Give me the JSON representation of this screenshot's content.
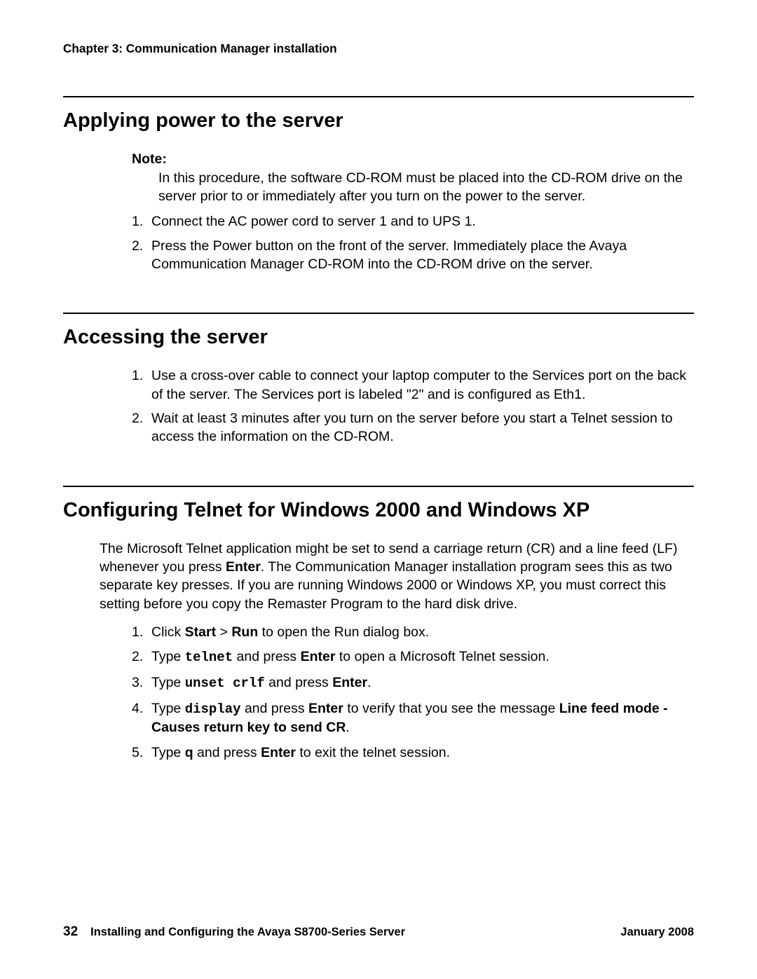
{
  "chapterHeader": "Chapter 3: Communication Manager installation",
  "section1": {
    "title": "Applying power to the server",
    "noteLabel": "Note:",
    "noteText": "In this procedure, the software CD-ROM must be placed into the CD-ROM drive on the server prior to or immediately after you turn on the power to the server.",
    "steps": [
      "Connect the AC power cord to server 1 and to UPS 1.",
      "Press the Power button on the front of the server. Immediately place the Avaya Communication Manager CD-ROM into the CD-ROM drive on the server."
    ]
  },
  "section2": {
    "title": "Accessing the server",
    "steps": [
      "Use a cross-over cable to connect your laptop computer to the Services port on the back of the server. The Services port is labeled \"2\" and is configured as Eth1.",
      "Wait at least 3 minutes after you turn on the server before you start a Telnet session to access the information on the CD-ROM."
    ]
  },
  "section3": {
    "title": "Configuring Telnet for Windows 2000 and Windows XP",
    "intro": {
      "p1a": "The Microsoft Telnet application might be set to send a carriage return (CR) and a line feed (LF) whenever you press ",
      "p1b": "Enter",
      "p1c": ". The Communication Manager installation program sees this as two separate key presses. If you are running Windows 2000 or Windows XP, you must correct this setting before you copy the Remaster Program to the hard disk drive."
    },
    "steps": {
      "s1a": "Click ",
      "s1b": "Start",
      "s1c": " > ",
      "s1d": "Run",
      "s1e": " to open the Run dialog box.",
      "s2a": "Type ",
      "s2b": "telnet",
      "s2c": " and press ",
      "s2d": "Enter",
      "s2e": " to open a Microsoft Telnet session.",
      "s3a": "Type ",
      "s3b": "unset crlf",
      "s3c": " and press ",
      "s3d": "Enter",
      "s3e": ".",
      "s4a": "Type ",
      "s4b": "display",
      "s4c": " and press ",
      "s4d": "Enter",
      "s4e": " to verify that you see the message ",
      "s4f": "Line feed mode - Causes return key to send CR",
      "s4g": ".",
      "s5a": "Type ",
      "s5b": "q",
      "s5c": " and press ",
      "s5d": "Enter",
      "s5e": " to exit the telnet session."
    }
  },
  "footer": {
    "pageNumber": "32",
    "docTitle": "Installing and Configuring the Avaya S8700-Series Server",
    "docDate": "January 2008"
  },
  "numbers": {
    "n1": "1.",
    "n2": "2.",
    "n3": "3.",
    "n4": "4.",
    "n5": "5."
  }
}
